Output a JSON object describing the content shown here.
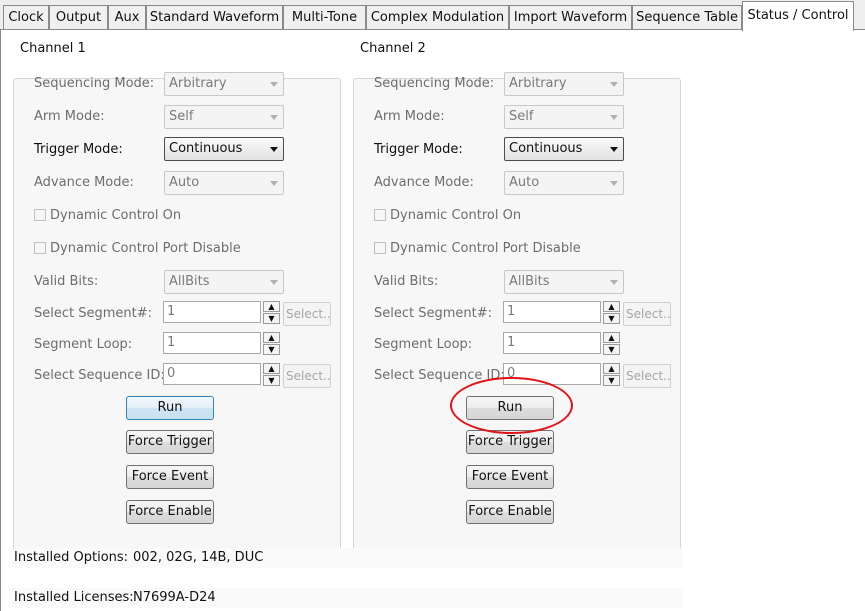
{
  "tabs": [
    {
      "label": "Clock"
    },
    {
      "label": "Output"
    },
    {
      "label": "Aux"
    },
    {
      "label": "Standard Waveform"
    },
    {
      "label": "Multi-Tone"
    },
    {
      "label": "Complex Modulation"
    },
    {
      "label": "Import Waveform"
    },
    {
      "label": "Sequence Table"
    },
    {
      "label": "Status / Control",
      "active": true
    }
  ],
  "labels": {
    "sequencing_mode": "Sequencing Mode:",
    "arm_mode": "Arm Mode:",
    "trigger_mode": "Trigger Mode:",
    "advance_mode": "Advance Mode:",
    "dynamic_control_on": "Dynamic Control On",
    "dynamic_control_port_disable": "Dynamic Control Port Disable",
    "valid_bits": "Valid Bits:",
    "select_segment": "Select Segment#:",
    "segment_loop": "Segment Loop:",
    "select_sequence_id": "Select Sequence ID:",
    "select_button": "Select..",
    "run": "Run",
    "force_trigger": "Force Trigger",
    "force_event": "Force Event",
    "force_enable": "Force Enable",
    "spin_up": "▲",
    "spin_down": "▼"
  },
  "channels": [
    {
      "title": "Channel 1",
      "sequencing_mode": "Arbitrary",
      "arm_mode": "Self",
      "trigger_mode": "Continuous",
      "advance_mode": "Auto",
      "dynamic_control_on": false,
      "dynamic_control_port_disable": false,
      "valid_bits": "AllBits",
      "select_segment": "1",
      "segment_loop": "1",
      "select_sequence_id": "0"
    },
    {
      "title": "Channel 2",
      "sequencing_mode": "Arbitrary",
      "arm_mode": "Self",
      "trigger_mode": "Continuous",
      "advance_mode": "Auto",
      "dynamic_control_on": false,
      "dynamic_control_port_disable": false,
      "valid_bits": "AllBits",
      "select_segment": "1",
      "segment_loop": "1",
      "select_sequence_id": "0"
    }
  ],
  "installed_options": {
    "label": "Installed Options:",
    "value": "002, 02G, 14B, DUC"
  },
  "installed_licenses": {
    "label": "Installed Licenses:",
    "value": "N7699A-D24"
  },
  "colors": {
    "highlight_ring": "#e0151b",
    "focus_border": "#3c7fb1"
  }
}
